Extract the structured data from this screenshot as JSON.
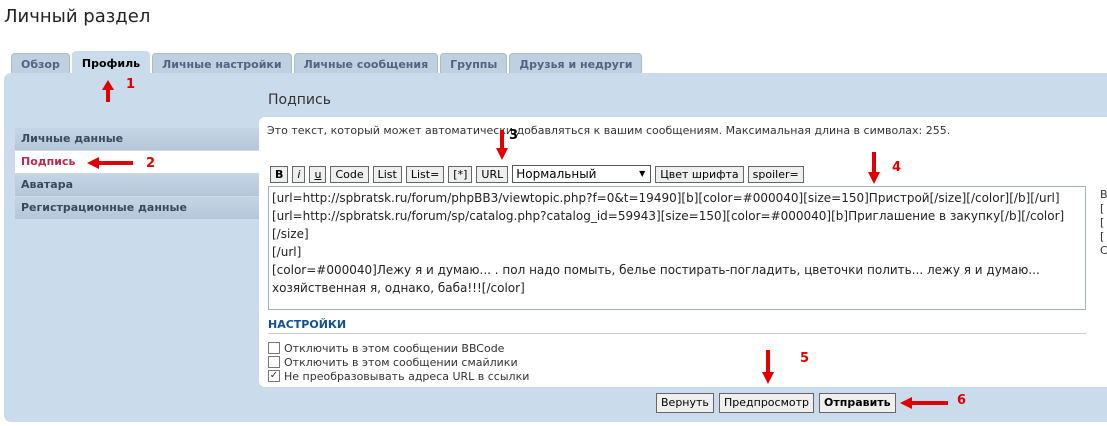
{
  "page": {
    "title": "Личный раздел"
  },
  "tabs": [
    {
      "label": "Обзор"
    },
    {
      "label": "Профиль",
      "active": true
    },
    {
      "label": "Личные настройки"
    },
    {
      "label": "Личные сообщения"
    },
    {
      "label": "Группы"
    },
    {
      "label": "Друзья и недруги"
    }
  ],
  "nav": [
    {
      "label": "Личные данные"
    },
    {
      "label": "Подпись",
      "active": true
    },
    {
      "label": "Аватара"
    },
    {
      "label": "Регистрационные данные"
    }
  ],
  "section": {
    "title": "Подпись",
    "description": "Это текст, который может автоматически добавляться к вашим сообщениям. Максимальная длина в символах: 255."
  },
  "toolbar": {
    "buttons": [
      "B",
      "i",
      "u",
      "Code",
      "List",
      "List=",
      "[*]",
      "URL"
    ],
    "size_value": "Нормальный",
    "font_color": "Цвет шрифта",
    "spoiler": "spoiler="
  },
  "editor": {
    "value": "[url=http://spbratsk.ru/forum/phpBB3/viewtopic.php?f=0&t=19490][b][color=#000040][size=150]Пристрой[/size][/color][/b][/url]\n[url=http://spbratsk.ru/forum/sp/catalog.php?catalog_id=59943][size=150][color=#000040][b]Приглашение в закупку[/b][/color][/size]\n[/url]\n[color=#000040]Лежу я и думаю... . пол надо помыть, белье постирать-погладить, цветочки полить... лежу я и думаю...\nхозяйственная я, однако, баба!!![/color]"
  },
  "settings": {
    "title": "НАСТРОЙКИ",
    "options": [
      {
        "label": "Отключить в этом сообщении BBCode",
        "checked": false
      },
      {
        "label": "Отключить в этом сообщении смайлики",
        "checked": false
      },
      {
        "label": "Не преобразовывать адреса URL в ссылки",
        "checked": true
      }
    ]
  },
  "actions": {
    "reset": "Вернуть",
    "preview": "Предпросмотр",
    "submit": "Отправить"
  },
  "annotations": [
    "1",
    "2",
    "3",
    "4",
    "5",
    "6"
  ],
  "colors": {
    "annotation": "#e00000",
    "tab_active_bg": "#cadceb",
    "nav_active_text": "#bc2a4d"
  }
}
